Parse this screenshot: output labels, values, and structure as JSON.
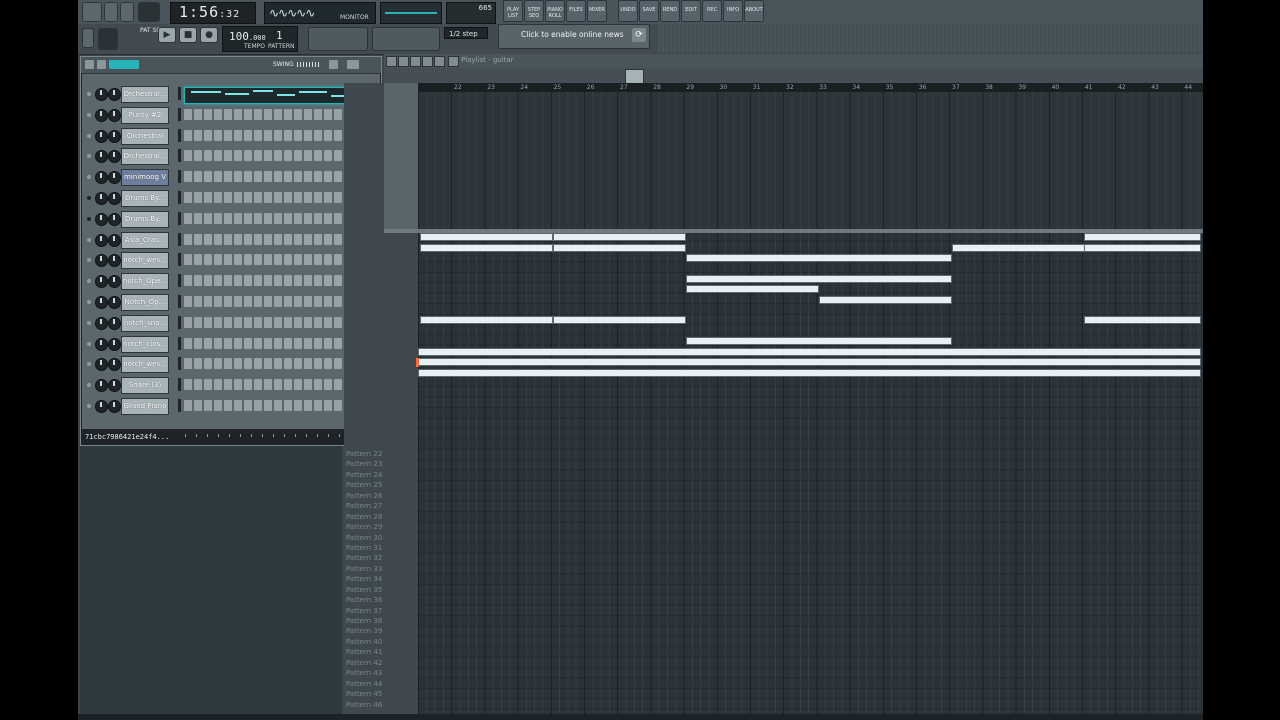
{
  "toolbar": {
    "time_main": "1:56",
    "time_sub": ":32",
    "monitor_label": "MONITOR",
    "monitor_wave": "∿∿∿∿∿",
    "cpu_value": "665",
    "buttons": [
      "PLAY LIST",
      "STEP SEQ",
      "PIANO ROLL",
      "FILES",
      "MIXER",
      "UNDO",
      "SAVE",
      "REND",
      "EDIT",
      "REC",
      "INFO",
      "ABOUT"
    ],
    "tempo": "100",
    "tempo_decimal": ".000",
    "tempo_label": "TEMPO",
    "pattern": "1",
    "pattern_label": "PATTERN",
    "pat_song": "PAT SONG",
    "snap": "1/2 step",
    "news": "Click to enable online news",
    "transport": [
      "▶",
      "■",
      "●"
    ]
  },
  "rack": {
    "swing_label": "SWING",
    "channels": [
      {
        "name": "Orchestral...",
        "piano": true,
        "led": "on"
      },
      {
        "name": "Purity #2",
        "led": "on"
      },
      {
        "name": "Orchestral",
        "led": "on"
      },
      {
        "name": "Orchestral...",
        "led": "on"
      },
      {
        "name": "minimoog V",
        "selected": true,
        "led": "on"
      },
      {
        "name": "Drums By...",
        "led": "off"
      },
      {
        "name": "Drums By...",
        "led": "off"
      },
      {
        "name": "Asia_Cras...",
        "led": "on"
      },
      {
        "name": "notch_wes...",
        "led": "on"
      },
      {
        "name": "notch_Ope...",
        "led": "on"
      },
      {
        "name": "Notch_Op...",
        "led": "on"
      },
      {
        "name": "notch_sna...",
        "led": "on"
      },
      {
        "name": "notch_clos...",
        "led": "on"
      },
      {
        "name": "notch_wes...",
        "led": "on"
      },
      {
        "name": "Snare (3)",
        "led": "on"
      },
      {
        "name": "Grand Piano",
        "led": "on"
      }
    ],
    "footer_id": "71cbc7986421e24f4..."
  },
  "playlist": {
    "title": "Playlist - guitar",
    "timeline": [
      "22",
      "23",
      "24",
      "25",
      "26",
      "27",
      "28",
      "29",
      "30",
      "31",
      "32",
      "33",
      "34",
      "35",
      "36",
      "37",
      "38",
      "39",
      "40",
      "41",
      "42",
      "43",
      "44"
    ],
    "patterns": [
      "Pattern 22",
      "Pattern 23",
      "Pattern 24",
      "Pattern 25",
      "Pattern 26",
      "Pattern 27",
      "Pattern 28",
      "Pattern 29",
      "Pattern 30",
      "Pattern 31",
      "Pattern 32",
      "Pattern 33",
      "Pattern 34",
      "Pattern 35",
      "Pattern 36",
      "Pattern 37",
      "Pattern 38",
      "Pattern 39",
      "Pattern 40",
      "Pattern 41",
      "Pattern 42",
      "Pattern 43",
      "Pattern 44",
      "Pattern 45",
      "Pattern 46"
    ]
  }
}
